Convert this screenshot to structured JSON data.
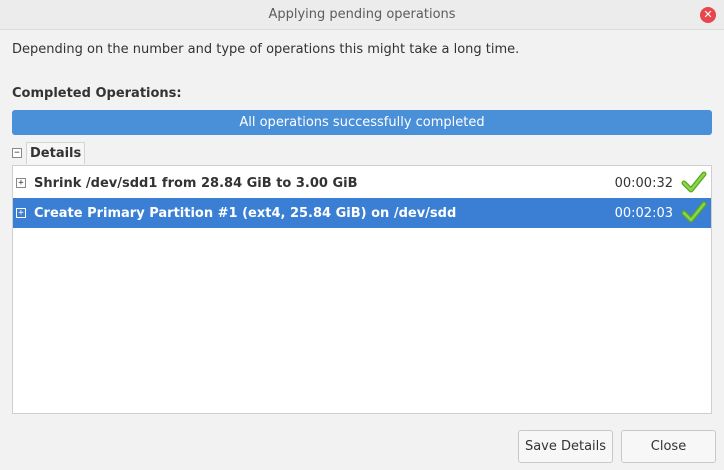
{
  "window": {
    "title": "Applying pending operations"
  },
  "description": "Depending on the number and type of operations this might take a long time.",
  "completed_label": "Completed Operations:",
  "progress": {
    "text": "All operations successfully completed",
    "fraction": 1.0
  },
  "details": {
    "toggle": "−",
    "label": "Details"
  },
  "operations": [
    {
      "expand": "+",
      "text": "Shrink /dev/sdd1 from 28.84 GiB to 3.00 GiB",
      "time": "00:00:32",
      "status_icon": "check-icon",
      "selected": false
    },
    {
      "expand": "+",
      "text": "Create Primary Partition #1 (ext4, 25.84 GiB) on /dev/sdd",
      "time": "00:02:03",
      "status_icon": "check-icon",
      "selected": true
    }
  ],
  "buttons": {
    "save_details": "Save Details",
    "close": "Close"
  },
  "colors": {
    "accent": "#4a90d9",
    "selection": "#3a7fd4",
    "success": "#73c52a",
    "close_button": "#e5474d"
  }
}
